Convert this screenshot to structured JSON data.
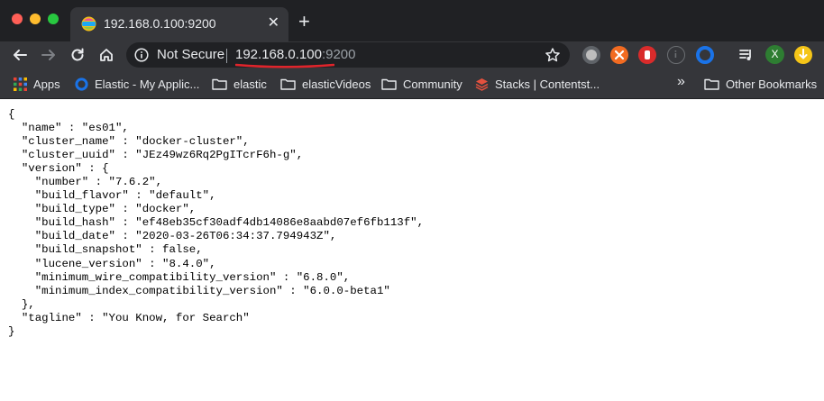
{
  "tab": {
    "title": "192.168.0.100:9200",
    "close_glyph": "✕",
    "new_tab_glyph": "+"
  },
  "toolbar": {
    "security_label": "Not Secure",
    "url_host": "192.168.0.100",
    "url_port": ":9200",
    "profile_initial": "X"
  },
  "bookmarks": {
    "apps": "Apps",
    "items": [
      "Elastic - My Applic...",
      "elastic",
      "elasticVideos",
      "Community",
      "Stacks | Contentst..."
    ],
    "overflow": "»",
    "other": "Other Bookmarks"
  },
  "json": {
    "lines": [
      "{",
      "  \"name\" : \"es01\",",
      "  \"cluster_name\" : \"docker-cluster\",",
      "  \"cluster_uuid\" : \"JEz49wz6Rq2PgITcrF6h-g\",",
      "  \"version\" : {",
      "    \"number\" : \"7.6.2\",",
      "    \"build_flavor\" : \"default\",",
      "    \"build_type\" : \"docker\",",
      "    \"build_hash\" : \"ef48eb35cf30adf4db14086e8aabd07ef6fb113f\",",
      "    \"build_date\" : \"2020-03-26T06:34:37.794943Z\",",
      "    \"build_snapshot\" : false,",
      "    \"lucene_version\" : \"8.4.0\",",
      "    \"minimum_wire_compatibility_version\" : \"6.8.0\",",
      "    \"minimum_index_compatibility_version\" : \"6.0.0-beta1\"",
      "  },",
      "  \"tagline\" : \"You Know, for Search\"",
      "}"
    ]
  },
  "colors": {
    "chrome_dark": "#202124",
    "chrome_toolbar": "#35363a",
    "annotation_red": "#e0242b"
  }
}
